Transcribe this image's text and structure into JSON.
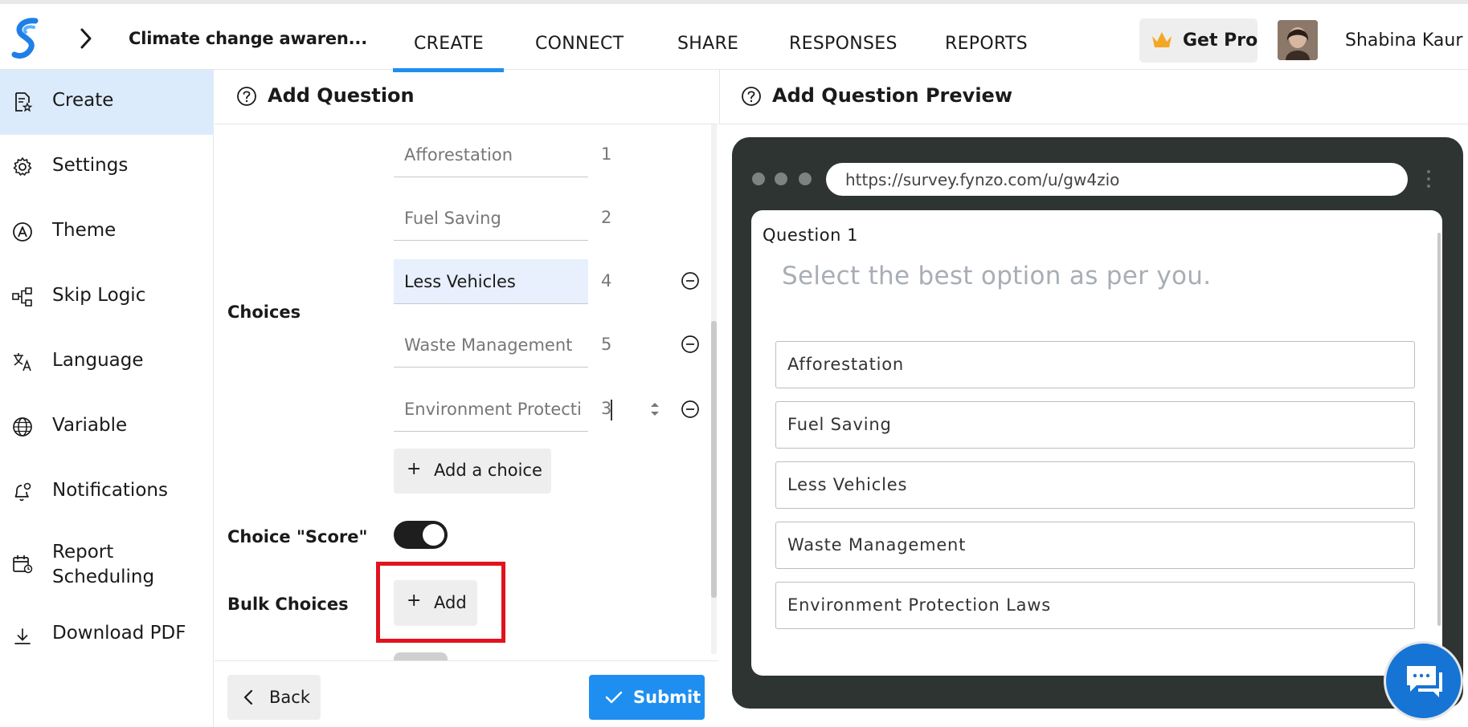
{
  "header": {
    "survey_title": "Climate change awaren...",
    "nav_tabs": [
      "CREATE",
      "CONNECT",
      "SHARE",
      "RESPONSES",
      "REPORTS"
    ],
    "active_tab": "CREATE",
    "get_pro_label": "Get Pro",
    "user_name": "Shabina Kaur D"
  },
  "sidebar": {
    "items": [
      {
        "label": "Create",
        "icon": "create-icon",
        "active": true
      },
      {
        "label": "Settings",
        "icon": "gear-icon"
      },
      {
        "label": "Theme",
        "icon": "theme-icon"
      },
      {
        "label": "Skip Logic",
        "icon": "skip-logic-icon"
      },
      {
        "label": "Language",
        "icon": "translate-icon"
      },
      {
        "label": "Variable",
        "icon": "globe-icon"
      },
      {
        "label": "Notifications",
        "icon": "bell-icon"
      },
      {
        "label": "Report Scheduling",
        "icon": "calendar-icon"
      },
      {
        "label": "Download PDF",
        "icon": "download-icon"
      }
    ]
  },
  "panel": {
    "title": "Add Question",
    "choices_label": "Choices",
    "choices": [
      {
        "value": "Afforestation",
        "score": "1",
        "removable": false
      },
      {
        "value": "Fuel Saving",
        "score": "2",
        "removable": false
      },
      {
        "value": "Less Vehicles",
        "score": "4",
        "removable": true,
        "focused": true
      },
      {
        "value": "Waste Management",
        "score": "5",
        "removable": true
      },
      {
        "value": "Environment Protecti",
        "score": "3",
        "removable": true,
        "editing": true
      }
    ],
    "add_choice_label": "Add a choice",
    "choice_score_label": "Choice \"Score\"",
    "choice_score_enabled": true,
    "bulk_choices_label": "Bulk Choices",
    "bulk_add_label": "Add",
    "back_label": "Back",
    "submit_label": "Submit"
  },
  "preview": {
    "title": "Add Question Preview",
    "url": "https://survey.fynzo.com/u/gw4zio",
    "question_number": "Question 1",
    "question_text": "Select the best option as per you.",
    "options": [
      "Afforestation",
      "Fuel Saving",
      "Less Vehicles",
      "Waste Management",
      "Environment Protection Laws"
    ]
  },
  "colors": {
    "accent": "#1e8ff0",
    "active_sidebar": "#dcebfb",
    "highlight": "#e0141e",
    "browser_frame": "#2e3432",
    "chat": "#1674d4"
  }
}
